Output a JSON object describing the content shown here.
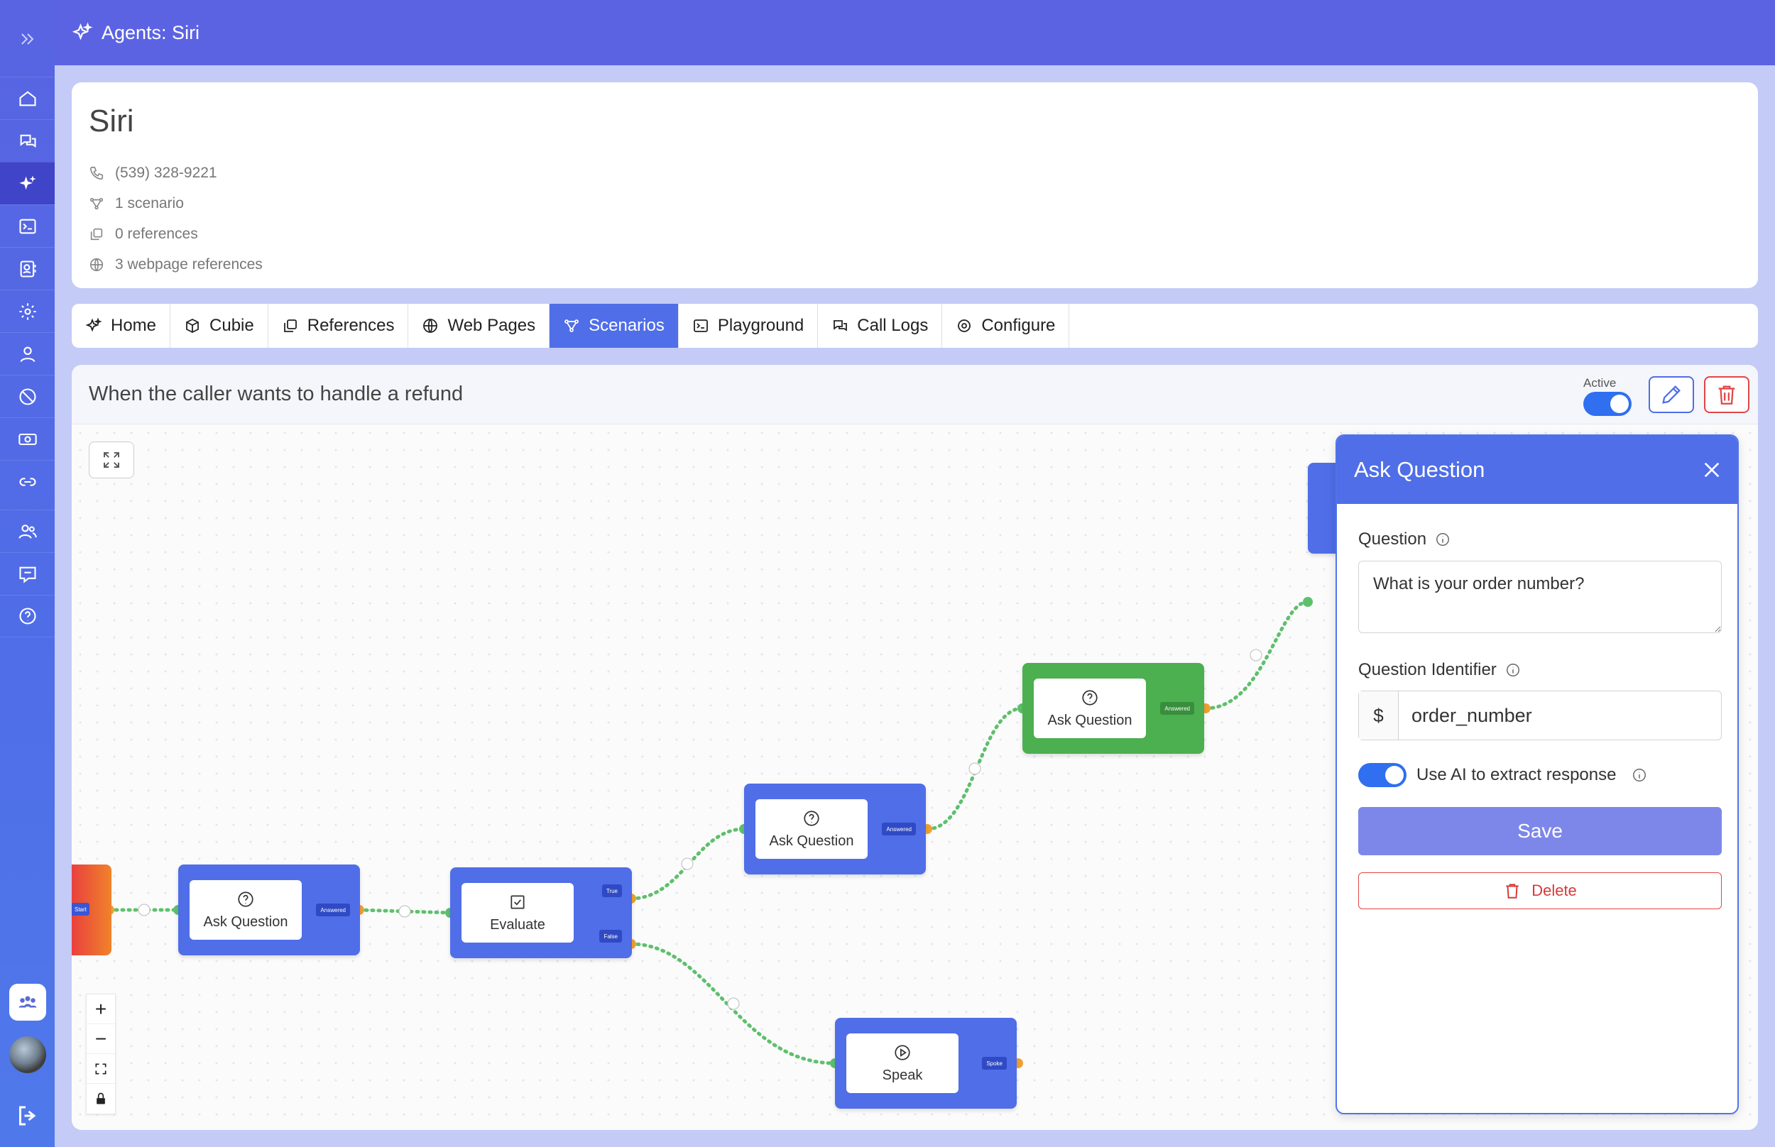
{
  "topbar": {
    "title": "Agents: Siri"
  },
  "agent": {
    "name": "Siri",
    "phone": "(539) 328-9221",
    "scenarios": "1 scenario",
    "references": "0 references",
    "webpages": "3 webpage references"
  },
  "tabs": [
    {
      "label": "Home",
      "icon": "sparkle-icon"
    },
    {
      "label": "Cubie",
      "icon": "cube-icon"
    },
    {
      "label": "References",
      "icon": "copy-icon"
    },
    {
      "label": "Web Pages",
      "icon": "globe-icon"
    },
    {
      "label": "Scenarios",
      "icon": "flow-icon",
      "active": true
    },
    {
      "label": "Playground",
      "icon": "terminal-icon"
    },
    {
      "label": "Call Logs",
      "icon": "chat-icon"
    },
    {
      "label": "Configure",
      "icon": "gear-icon"
    }
  ],
  "scenario": {
    "title": "When the caller wants to handle a refund",
    "active_label": "Active",
    "active": true
  },
  "flow": {
    "start": {
      "port": "Start"
    },
    "nodes": [
      {
        "label": "Ask Question",
        "port": "Answered",
        "icon": "question-icon"
      },
      {
        "label": "Evaluate",
        "port_true": "True",
        "port_false": "False",
        "icon": "checkbox-icon"
      },
      {
        "label": "Ask Question",
        "port": "Answered",
        "icon": "question-icon"
      },
      {
        "label": "Ask Question",
        "port": "Answered",
        "icon": "question-icon"
      },
      {
        "label": "Speak",
        "port": "Spoke",
        "icon": "play-icon"
      }
    ]
  },
  "panel": {
    "title": "Ask Question",
    "question_label": "Question",
    "question_value": "What is your order number?",
    "identifier_label": "Question Identifier",
    "identifier_prefix": "$",
    "identifier_value": "order_number",
    "ai_label": "Use AI to extract response",
    "ai_enabled": true,
    "save_label": "Save",
    "delete_label": "Delete"
  },
  "colors": {
    "brand": "#5c63e3",
    "accent": "#4f6ee8",
    "node_selected": "#4caf50",
    "edge": "#5ec06b",
    "danger": "#d73838"
  }
}
